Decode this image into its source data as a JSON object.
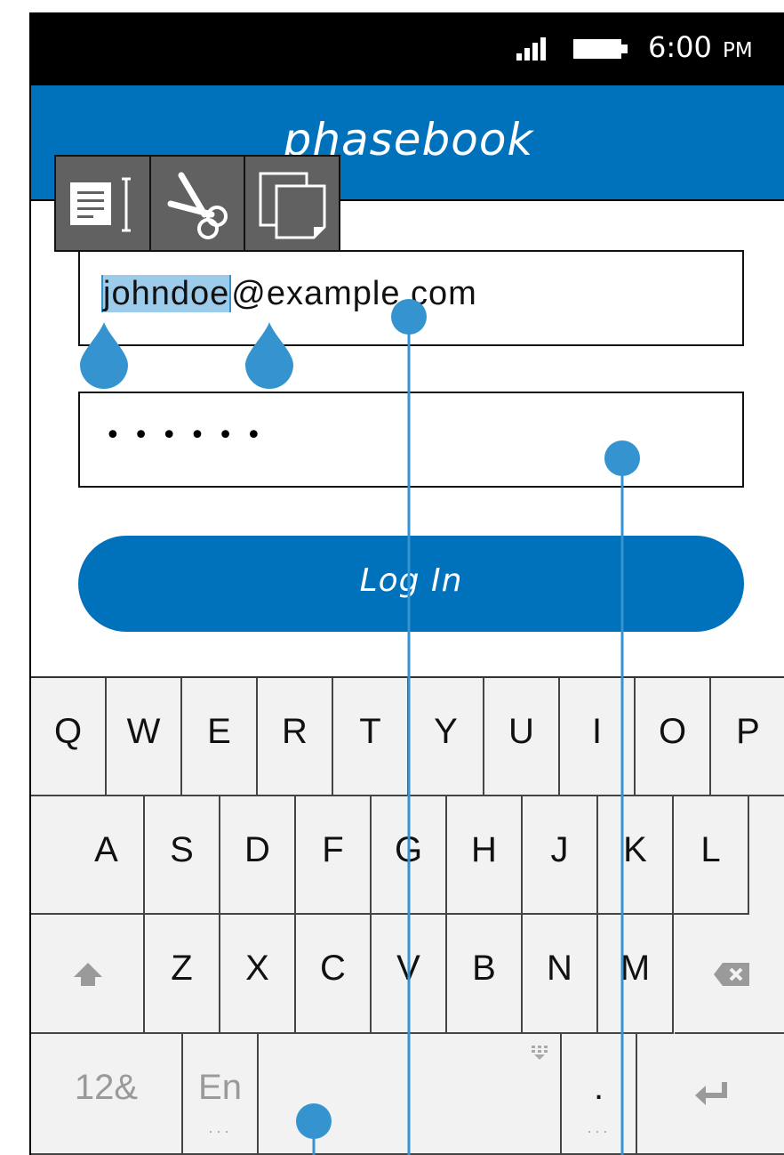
{
  "status_bar": {
    "time": "6:00",
    "ampm": "PM",
    "icons": [
      "signal-icon",
      "battery-icon"
    ]
  },
  "app": {
    "title": "phasebook"
  },
  "edit_toolbar": {
    "actions": [
      "select-all-icon",
      "cut-icon",
      "copy-icon"
    ]
  },
  "email": {
    "selected_text": "johndoe",
    "rest_text": "@example.com"
  },
  "password": {
    "masked": "••••••"
  },
  "login": {
    "label": "Log In"
  },
  "keyboard": {
    "row1": [
      "Q",
      "W",
      "E",
      "R",
      "T",
      "Y",
      "U",
      "I",
      "O",
      "P"
    ],
    "row2": [
      "A",
      "S",
      "D",
      "F",
      "G",
      "H",
      "J",
      "K",
      "L"
    ],
    "row3": [
      "Z",
      "X",
      "C",
      "V",
      "B",
      "N",
      "M"
    ],
    "numbers_label": "12&",
    "language_label": "En",
    "period_label": "."
  },
  "colors": {
    "accent": "#0072bc",
    "selection": "#9dcbea",
    "handle": "#3594cf",
    "toolbar": "#616161",
    "keyboard_bg": "#f2f2f2"
  }
}
